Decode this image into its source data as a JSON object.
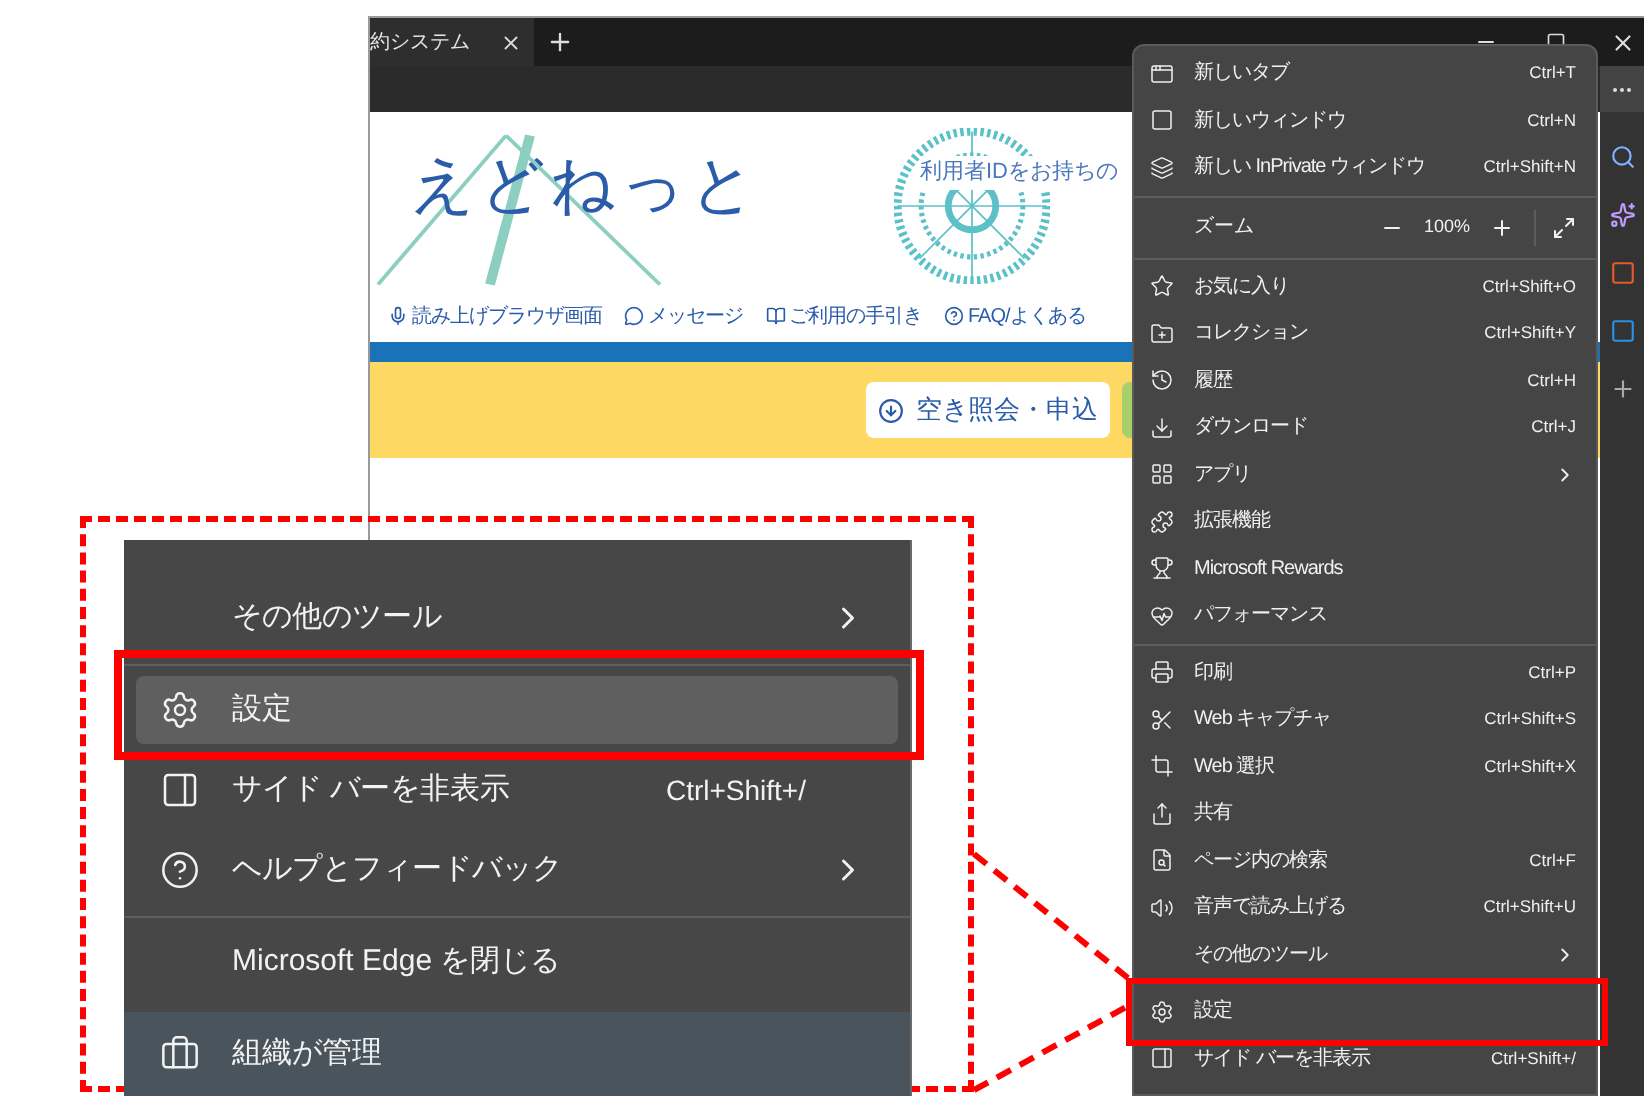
{
  "browser": {
    "tab_title": "約システム"
  },
  "page": {
    "logo": "えどねっと",
    "login_hint": "利用者IDをお持ちの",
    "nav_links": [
      "読み上げブラウザ画面",
      "メッセージ",
      "ご利用の手引き",
      "FAQ/よくある"
    ],
    "search_button": "空き照会・申込"
  },
  "menu": {
    "items": [
      {
        "kind": "item",
        "label": "新しいタブ",
        "shortcut": "Ctrl+T",
        "has_submenu": false,
        "marked": false
      },
      {
        "kind": "item",
        "label": "新しいウィンドウ",
        "shortcut": "Ctrl+N",
        "has_submenu": false,
        "marked": false
      },
      {
        "kind": "item",
        "label": "新しい InPrivate ウィンドウ",
        "shortcut": "Ctrl+Shift+N",
        "has_submenu": false,
        "marked": false
      },
      {
        "kind": "divider"
      },
      {
        "kind": "zoom",
        "label": "ズーム",
        "value": "100%"
      },
      {
        "kind": "divider"
      },
      {
        "kind": "item",
        "label": "お気に入り",
        "shortcut": "Ctrl+Shift+O",
        "has_submenu": false,
        "marked": false
      },
      {
        "kind": "item",
        "label": "コレクション",
        "shortcut": "Ctrl+Shift+Y",
        "has_submenu": false,
        "marked": false
      },
      {
        "kind": "item",
        "label": "履歴",
        "shortcut": "Ctrl+H",
        "has_submenu": false,
        "marked": false
      },
      {
        "kind": "item",
        "label": "ダウンロード",
        "shortcut": "Ctrl+J",
        "has_submenu": false,
        "marked": false
      },
      {
        "kind": "item",
        "label": "アプリ",
        "has_submenu": true,
        "marked": false
      },
      {
        "kind": "item",
        "label": "拡張機能",
        "has_submenu": false,
        "marked": false
      },
      {
        "kind": "item",
        "label": "Microsoft Rewards",
        "has_submenu": false,
        "marked": false
      },
      {
        "kind": "item",
        "label": "パフォーマンス",
        "has_submenu": false,
        "marked": false
      },
      {
        "kind": "divider"
      },
      {
        "kind": "item",
        "label": "印刷",
        "shortcut": "Ctrl+P",
        "has_submenu": false,
        "marked": false
      },
      {
        "kind": "item",
        "label": "Web キャプチャ",
        "shortcut": "Ctrl+Shift+S",
        "has_submenu": false,
        "marked": false
      },
      {
        "kind": "item",
        "label": "Web 選択",
        "shortcut": "Ctrl+Shift+X",
        "has_submenu": false,
        "marked": false
      },
      {
        "kind": "item",
        "label": "共有",
        "has_submenu": false,
        "marked": false
      },
      {
        "kind": "item",
        "label": "ページ内の検索",
        "shortcut": "Ctrl+F",
        "has_submenu": false,
        "marked": false
      },
      {
        "kind": "item",
        "label": "音声で読み上げる",
        "shortcut": "Ctrl+Shift+U",
        "has_submenu": false,
        "marked": false
      },
      {
        "kind": "item",
        "label": "その他のツール",
        "has_submenu": true,
        "marked": false
      },
      {
        "kind": "divider"
      },
      {
        "kind": "item",
        "label": "設定",
        "has_submenu": false,
        "marked": true
      },
      {
        "kind": "item",
        "label": "サイド バーを非表示",
        "shortcut": "Ctrl+Shift+/",
        "has_submenu": false,
        "marked": false
      }
    ]
  },
  "callout": {
    "items": [
      {
        "kind": "item",
        "label": "その他のツール",
        "has_submenu": true,
        "selected": false,
        "marked": false
      },
      {
        "kind": "divider"
      },
      {
        "kind": "item",
        "label": "設定",
        "has_submenu": false,
        "selected": true,
        "marked": true
      },
      {
        "kind": "item",
        "label": "サイド バーを非表示",
        "shortcut": "Ctrl+Shift+/",
        "has_submenu": false,
        "selected": false,
        "marked": false
      },
      {
        "kind": "item",
        "label": "ヘルプとフィードバック",
        "has_submenu": true,
        "selected": false,
        "marked": false
      },
      {
        "kind": "divider"
      },
      {
        "kind": "item",
        "label": "Microsoft Edge を閉じる",
        "has_submenu": false,
        "selected": false,
        "marked": false
      },
      {
        "kind": "footer",
        "label": "組織が管理"
      }
    ]
  }
}
